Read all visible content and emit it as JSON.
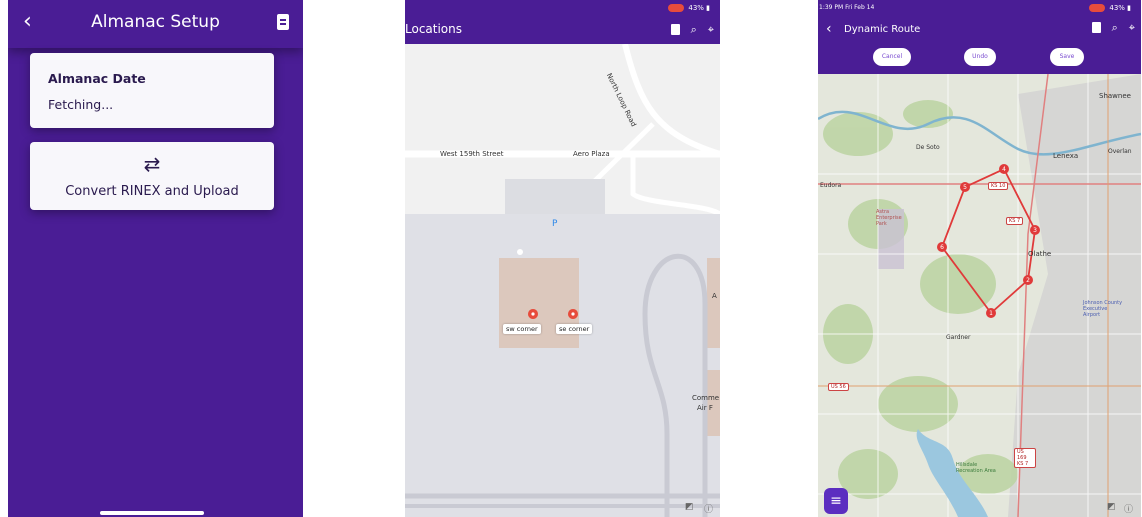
{
  "almanac": {
    "title": "Almanac Setup",
    "icons": {
      "back": "back-chevron-icon",
      "log": "document-icon"
    },
    "date_card": {
      "label": "Almanac Date",
      "value": "Fetching..."
    },
    "convert_card": {
      "icon": "swap-arrows-icon",
      "label": "Convert RINEX and Upload"
    }
  },
  "locations": {
    "title": "Locations",
    "status": "43%",
    "icons": [
      "document-icon",
      "search-icon",
      "locate-icon"
    ],
    "streets": {
      "west159": "West 159th Street",
      "aero_plaza": "Aero Plaza",
      "north_loop": "North Loop Road"
    },
    "parking": "P",
    "markers": [
      {
        "label": "sw corner"
      },
      {
        "label": "se corner"
      }
    ],
    "edge_labels": [
      "A",
      "Comme",
      "Air F"
    ],
    "attribution": [
      "maps-icon",
      "info-icon"
    ]
  },
  "route": {
    "time": "1:39 PM  Fri Feb 14",
    "status": "43%",
    "title": "Dynamic Route",
    "buttons": {
      "cancel": "Cancel",
      "undo": "Undo",
      "save": "Save"
    },
    "icons": [
      "document-icon",
      "search-icon",
      "locate-icon"
    ],
    "places": {
      "shawnee": "Shawnee",
      "de_soto": "De Soto",
      "lenexa": "Lenexa",
      "overland": "Overlan",
      "eudora": "Eudora",
      "olathe": "Olathe",
      "gardner": "Gardner",
      "hillsdale": "Hillsdale Recreation Area",
      "astra": "Astra Enterprise Park",
      "johnson": "Johnson County Executive Airport"
    },
    "shields": {
      "ks10": "KS 10",
      "ks7": "KS 7",
      "us56": "US 56",
      "us169": "US 169 KS 7"
    },
    "waypoints": [
      "1",
      "2",
      "3",
      "4",
      "5",
      "6"
    ],
    "fab_icon": "menu-icon",
    "colors": {
      "route": "#e03a3a",
      "header": "#4a1d95"
    }
  }
}
